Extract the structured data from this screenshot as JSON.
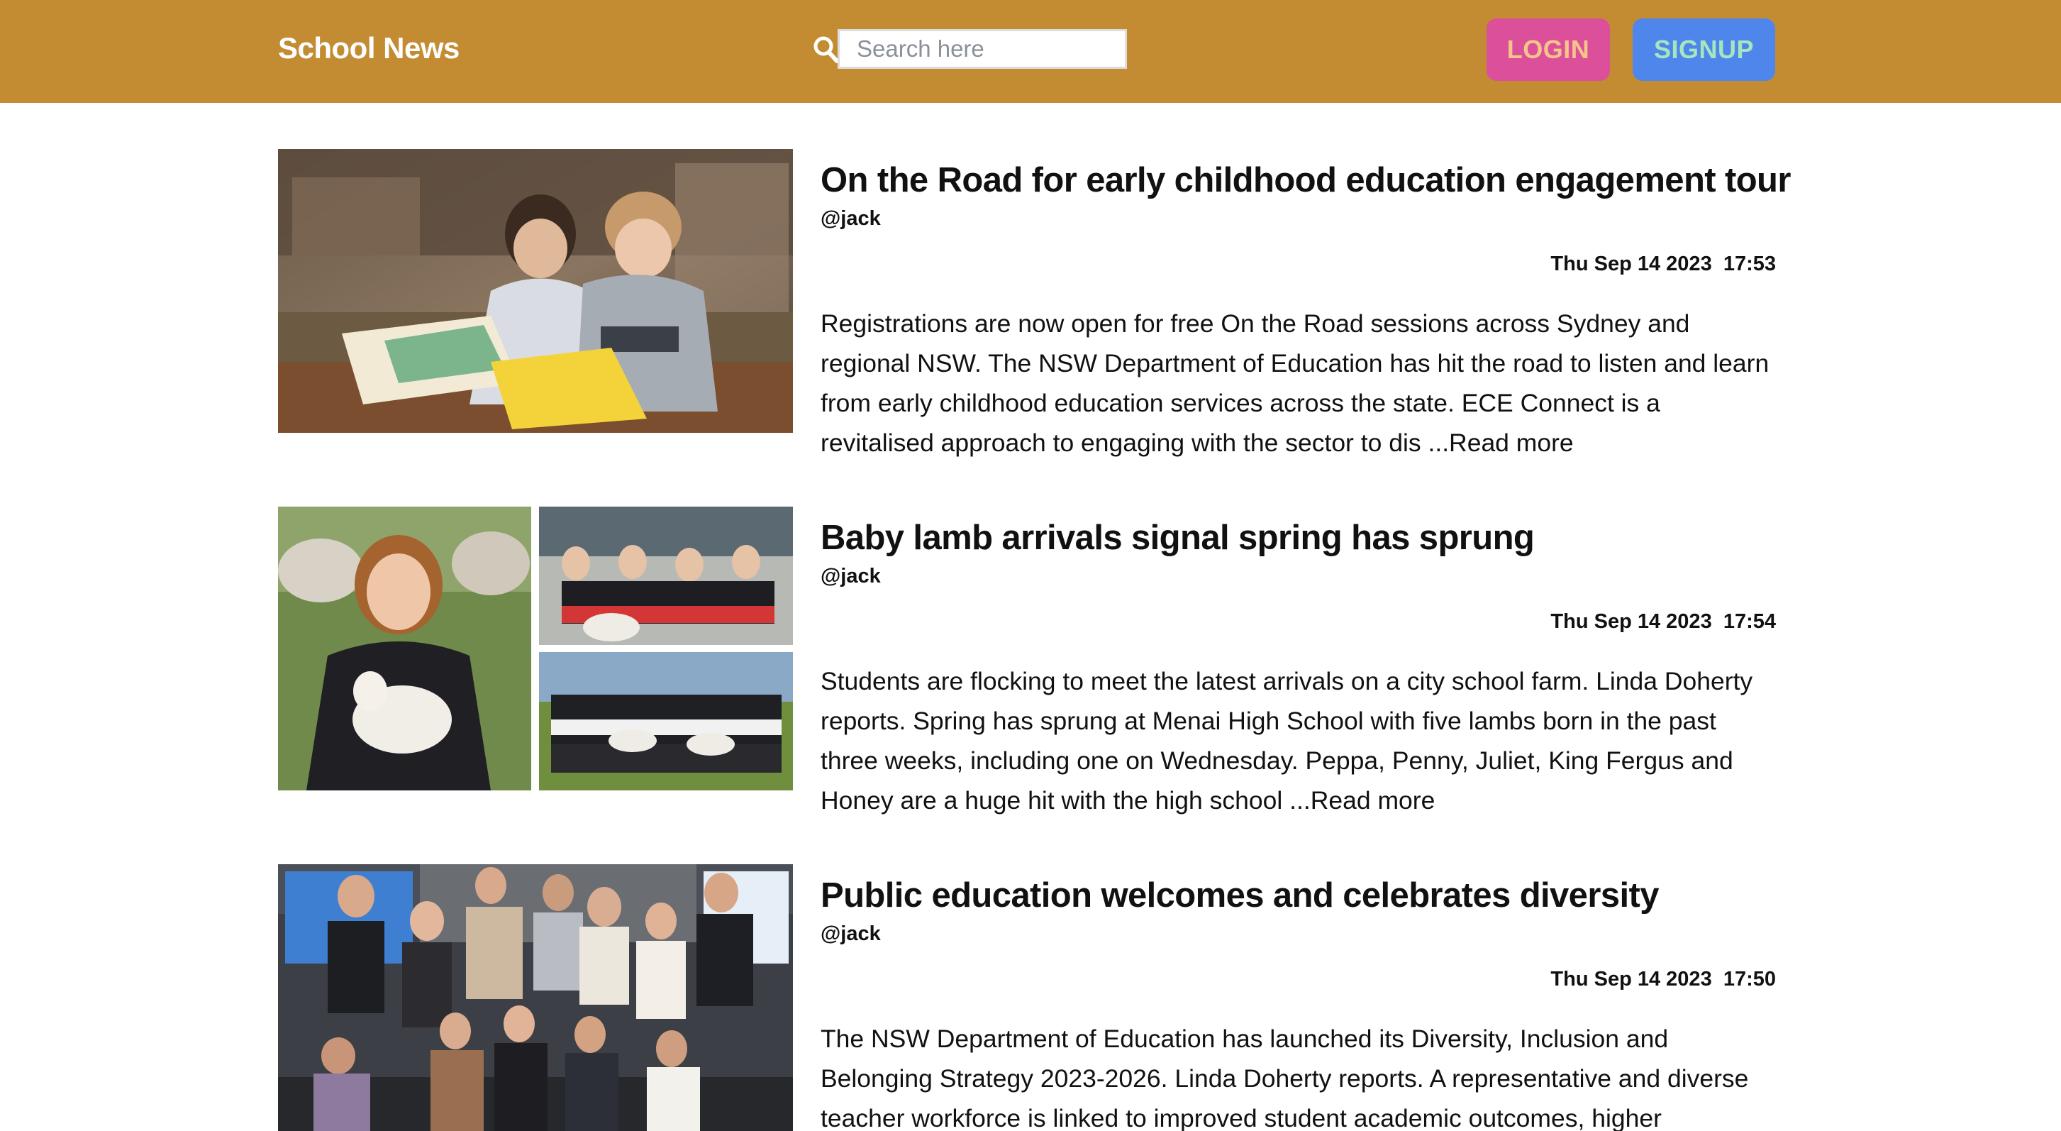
{
  "header": {
    "brand": "School News",
    "search_placeholder": "Search here",
    "search_value": "",
    "login_label": "LOGIN",
    "signup_label": "SIGNUP"
  },
  "colors": {
    "navbar_background": "#c38c33",
    "login_button": "#dc4f9a",
    "signup_button": "#4f86ec"
  },
  "articles": [
    {
      "title": "On the Road for early childhood education engagement tour",
      "author": "@jack",
      "date": "Thu Sep 14 2023",
      "time": "17:53",
      "excerpt": "Registrations are now open for free On the Road sessions across Sydney and regional NSW. The NSW Department of Education has hit the road to listen and learn from early childhood education services across the state. ECE Connect is a revitalised approach to engaging with the sector to dis ",
      "read_more": "...Read more"
    },
    {
      "title": "Baby lamb arrivals signal spring has sprung",
      "author": "@jack",
      "date": "Thu Sep 14 2023",
      "time": "17:54",
      "excerpt": "Students are flocking to meet the latest arrivals on a city school farm. Linda Doherty reports. Spring has sprung at Menai High School with five lambs born in the past three weeks, including one on Wednesday. Peppa, Penny, Juliet, King Fergus and Honey are a huge hit with the high school ",
      "read_more": "...Read more"
    },
    {
      "title": "Public education welcomes and celebrates diversity",
      "author": "@jack",
      "date": "Thu Sep 14 2023",
      "time": "17:50",
      "excerpt": "The NSW Department of Education has launched its Diversity, Inclusion and Belonging Strategy 2023-2026. Linda Doherty reports. A representative and diverse teacher workforce is linked to improved student academic outcomes, higher"
    }
  ]
}
